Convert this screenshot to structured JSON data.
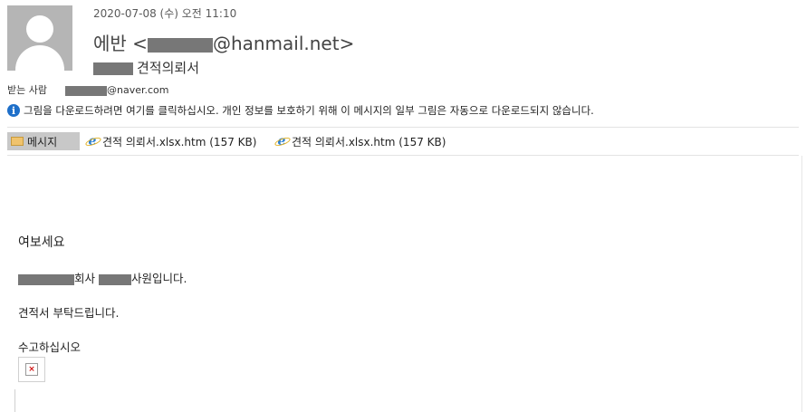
{
  "header": {
    "date": "2020-07-08 (수) 오전 11:10",
    "sender_name": "에반",
    "sender_open": "<",
    "sender_domain": "@hanmail.net",
    "sender_close": ">",
    "subject": "견적의뢰서",
    "to_label": "받는 사람",
    "to_domain": "@naver.com"
  },
  "info_bar": {
    "text": "그림을 다운로드하려면 여기를 클릭하십시오. 개인 정보를 보호하기 위해 이 메시지의 일부 그림은 자동으로 다운로드되지 않습니다."
  },
  "attachments": {
    "message_tab": "메시지",
    "items": [
      {
        "label": "견적 의뢰서.xlsx.htm (157 KB)"
      },
      {
        "label": "견적 의뢰서.xlsx.htm (157 KB)"
      }
    ]
  },
  "body": {
    "greeting": "여보세요",
    "line1_mid": "회사",
    "line1_end": "사원입니다.",
    "line2": "견적서 부탁드립니다.",
    "line3": "수고하십시오"
  },
  "icons": {
    "avatar": "person-silhouette",
    "info": "info-icon",
    "message": "envelope-icon",
    "attachment": "internet-explorer-icon",
    "broken_image": "broken-image-icon"
  },
  "colors": {
    "redaction": "#777777",
    "active_tab": "#c8c8c8",
    "info_icon": "#1e6fc9"
  }
}
